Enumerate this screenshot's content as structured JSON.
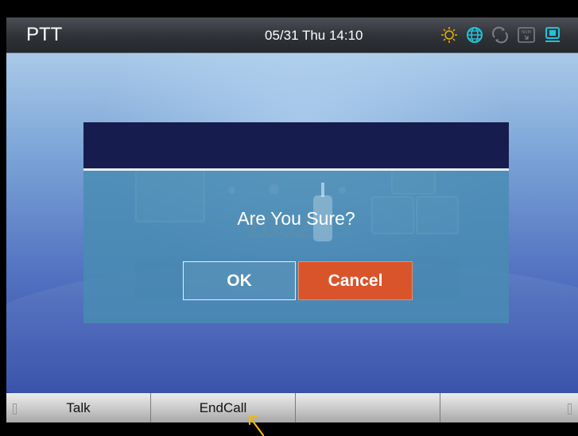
{
  "statusbar": {
    "title": "PTT",
    "datetime": "05/31 Thu 14:10",
    "icons": [
      "brightness-icon",
      "globe-icon",
      "sync-icon",
      "num-lock-icon",
      "screen-icon"
    ],
    "icon_color": "#f0b400",
    "active_icon_color": "#22c3d8"
  },
  "call_background": {
    "number": "1002"
  },
  "dialog": {
    "message": "Are You Sure?",
    "ok_label": "OK",
    "cancel_label": "Cancel",
    "cancel_color": "#d9542a"
  },
  "softkeys": {
    "items": [
      "Talk",
      "EndCall",
      "",
      ""
    ]
  }
}
